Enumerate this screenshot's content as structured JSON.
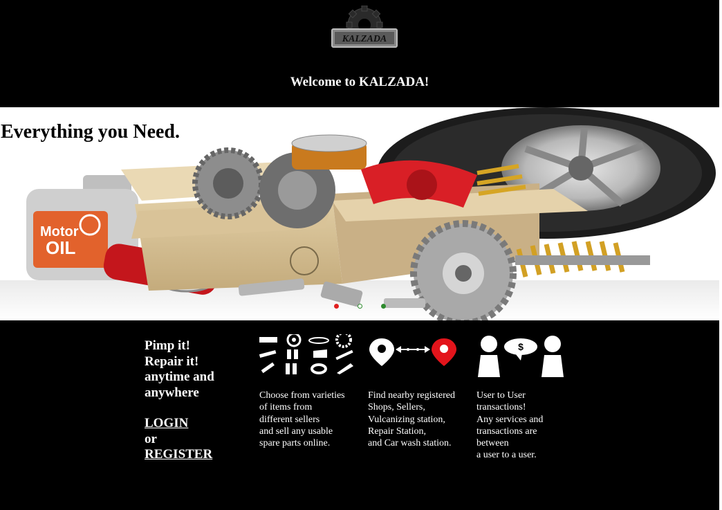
{
  "header": {
    "logo_text": "KALZADA",
    "welcome": "Welcome to KALZADA!"
  },
  "hero": {
    "tagline": "Everything you Need.",
    "oil_label_1": "Motor",
    "oil_label_2": "OIL",
    "carousel_dots": [
      "active",
      "inactive",
      "inactive"
    ],
    "colors": {
      "active_dot": "#e02020",
      "inactive_dot": "#2e8b2e"
    }
  },
  "cta": {
    "line1": "Pimp it!",
    "line2": "Repair it!",
    "line3": "anytime and",
    "line4": "anywhere",
    "login": "LOGIN",
    "or": "or",
    "register": "REGISTER"
  },
  "features": [
    {
      "icon": "parts-grid-icon",
      "text": "Choose from varieties\nof items from\ndifferent sellers\nand sell any usable\nspare parts online."
    },
    {
      "icon": "location-route-icon",
      "text": "Find nearby registered\nShops, Sellers,\nVulcanizing station,\nRepair Station,\nand Car wash station."
    },
    {
      "icon": "user-transaction-icon",
      "text": "User to User\ntransactions!\nAny services and\ntransactions are\nbetween\na user to a user."
    }
  ]
}
